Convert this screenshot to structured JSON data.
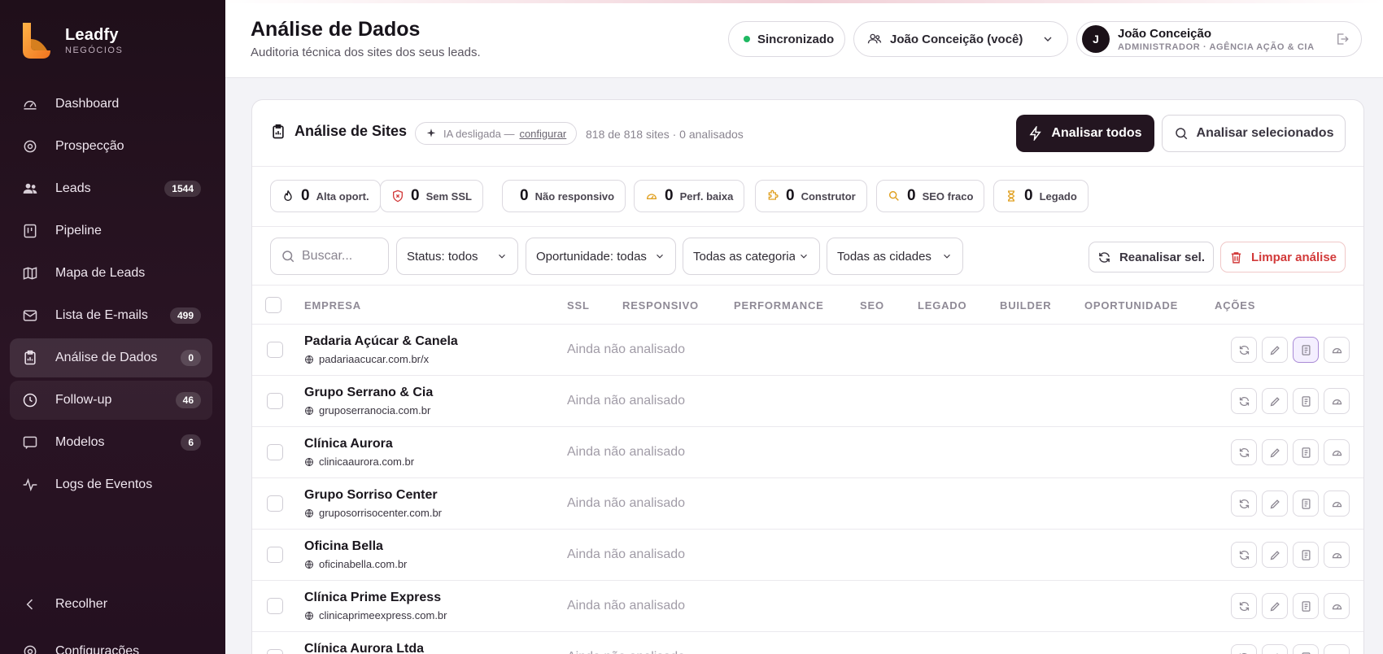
{
  "brand": {
    "name": "Leadfy",
    "sub": "NEGÓCIOS"
  },
  "sidebar": {
    "items": [
      {
        "label": "Dashboard",
        "icon": "gauge-icon",
        "badge": ""
      },
      {
        "label": "Prospecção",
        "icon": "target-icon",
        "badge": ""
      },
      {
        "label": "Leads",
        "icon": "users-icon",
        "badge": "1544"
      },
      {
        "label": "Pipeline",
        "icon": "kanban-icon",
        "badge": ""
      },
      {
        "label": "Mapa de Leads",
        "icon": "map-icon",
        "badge": ""
      },
      {
        "label": "Lista de E-mails",
        "icon": "mail-icon",
        "badge": "499"
      },
      {
        "label": "Análise de Dados",
        "icon": "report-icon",
        "badge": "0"
      },
      {
        "label": "Follow-up",
        "icon": "clock-icon",
        "badge": "46"
      },
      {
        "label": "Modelos",
        "icon": "template-icon",
        "badge": "6"
      },
      {
        "label": "Logs de Eventos",
        "icon": "activity-icon",
        "badge": ""
      }
    ],
    "collapse_label": "Recolher",
    "settings_label": "Configurações"
  },
  "header": {
    "title": "Análise de Dados",
    "subtitle": "Auditoria técnica dos sites dos seus leads.",
    "sync_label": "Sincronizado",
    "user_select": "João Conceição (você)",
    "profile_name": "João Conceição",
    "profile_role": "ADMINISTRADOR · AGÊNCIA AÇÃO & CIA",
    "avatar_initial": "J"
  },
  "card": {
    "title": "Análise de Sites",
    "ia_text": "IA desligada —",
    "ia_link": "configurar",
    "count_text": "818 de 818 sites · 0 analisados",
    "analyze_all": "Analisar todos",
    "analyze_selected": "Analisar selecionados"
  },
  "stats": [
    {
      "value": "0",
      "label": "Alta oport.",
      "icon": "flame-icon"
    },
    {
      "value": "0",
      "label": "Sem SSL",
      "icon": "shield-x-icon"
    },
    {
      "value": "0",
      "label": "Não responsivo",
      "icon": ""
    },
    {
      "value": "0",
      "label": "Perf. baixa",
      "icon": "gauge-icon"
    },
    {
      "value": "0",
      "label": "Construtor",
      "icon": "puzzle-icon"
    },
    {
      "value": "0",
      "label": "SEO fraco",
      "icon": "search-icon"
    },
    {
      "value": "0",
      "label": "Legado",
      "icon": "hourglass-icon"
    }
  ],
  "filters": {
    "search_placeholder": "Buscar...",
    "status": "Status: todos",
    "opportunity": "Oportunidade: todas",
    "category": "Todas as categorias",
    "city": "Todas as cidades",
    "reanalyze": "Reanalisar sel.",
    "clear": "Limpar análise"
  },
  "table": {
    "headers": [
      "EMPRESA",
      "SSL",
      "RESPONSIVO",
      "PERFORMANCE",
      "SEO",
      "LEGADO",
      "BUILDER",
      "OPORTUNIDADE",
      "AÇÕES"
    ],
    "rows": [
      {
        "name": "Padaria Açúcar & Canela",
        "url": "padariaacucar.com.br/x",
        "status": "Ainda não analisado"
      },
      {
        "name": "Grupo Serrano & Cia",
        "url": "gruposerranocia.com.br",
        "status": "Ainda não analisado"
      },
      {
        "name": "Clínica Aurora",
        "url": "clinicaaurora.com.br",
        "status": "Ainda não analisado"
      },
      {
        "name": "Grupo Sorriso Center",
        "url": "gruposorrisocenter.com.br",
        "status": "Ainda não analisado"
      },
      {
        "name": "Oficina Bella",
        "url": "oficinabella.com.br",
        "status": "Ainda não analisado"
      },
      {
        "name": "Clínica Prime Express",
        "url": "clinicaprimeexpress.com.br",
        "status": "Ainda não analisado"
      },
      {
        "name": "Clínica Aurora Ltda",
        "url": "",
        "status": "Ainda não analisado"
      }
    ]
  },
  "colors": {
    "accent_dark": "#231520",
    "danger": "#d23a3a",
    "sync": "#1fb862",
    "brand_orange": "#f5a623"
  }
}
